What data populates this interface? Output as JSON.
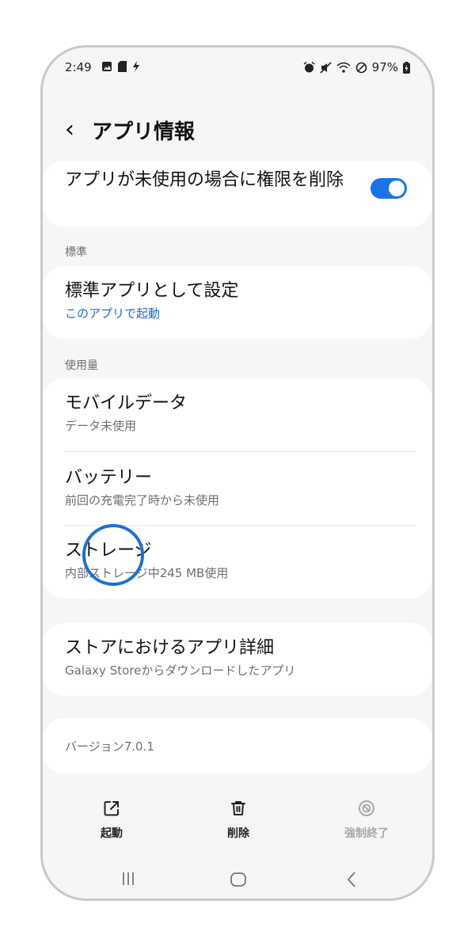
{
  "status": {
    "time": "2:49",
    "battery": "97%"
  },
  "header": {
    "back_icon": "back-chevron-icon",
    "title": "アプリ情報"
  },
  "permission": {
    "label": "アプリが未使用の場合に権限を削除",
    "toggle_on": true
  },
  "sections": {
    "standard": "標準",
    "usage": "使用量"
  },
  "default_app": {
    "title": "標準アプリとして設定",
    "subtitle": "このアプリで起動"
  },
  "mobile_data": {
    "title": "モバイルデータ",
    "subtitle": "データ未使用"
  },
  "battery": {
    "title": "バッテリー",
    "subtitle": "前回の充電完了時から未使用"
  },
  "storage": {
    "title": "ストレージ",
    "subtitle": "内部ストレージ中245 MB使用"
  },
  "store_details": {
    "title": "ストアにおけるアプリ詳細",
    "subtitle": "Galaxy Storeからダウンロードしたアプリ"
  },
  "version": {
    "text": "バージョン7.0.1"
  },
  "actions": {
    "open": "起動",
    "uninstall": "削除",
    "force_stop": "強制終了"
  },
  "colors": {
    "accent": "#1a73e8",
    "link": "#1769d2",
    "ring": "#1a6fd6"
  }
}
